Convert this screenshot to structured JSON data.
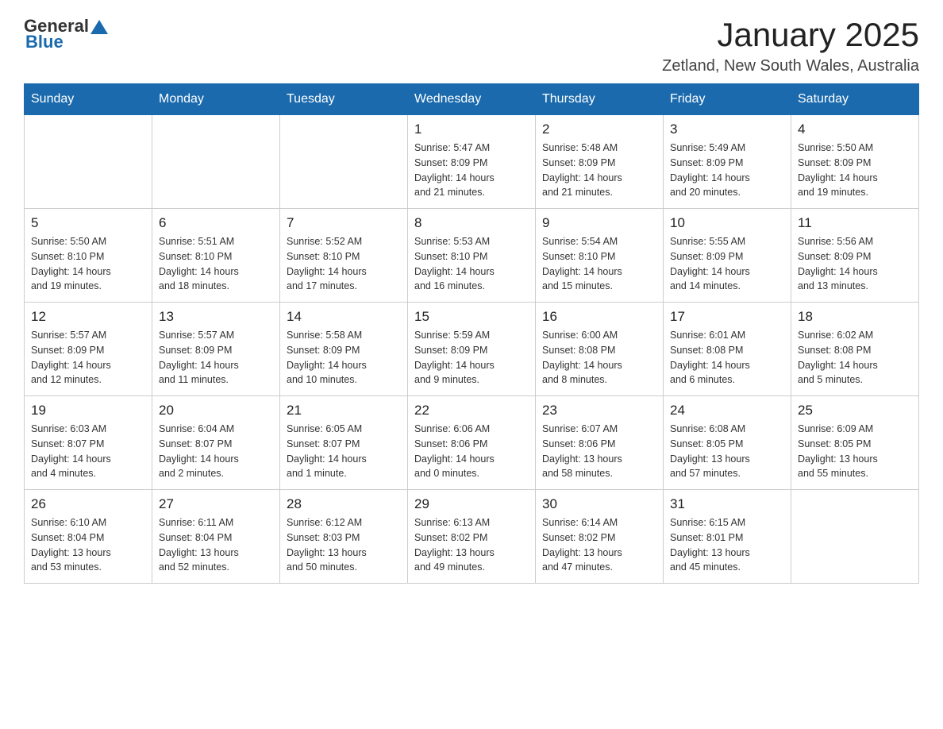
{
  "logo": {
    "general": "General",
    "blue": "Blue"
  },
  "title": "January 2025",
  "location": "Zetland, New South Wales, Australia",
  "days_of_week": [
    "Sunday",
    "Monday",
    "Tuesday",
    "Wednesday",
    "Thursday",
    "Friday",
    "Saturday"
  ],
  "weeks": [
    [
      {
        "day": "",
        "info": ""
      },
      {
        "day": "",
        "info": ""
      },
      {
        "day": "",
        "info": ""
      },
      {
        "day": "1",
        "info": "Sunrise: 5:47 AM\nSunset: 8:09 PM\nDaylight: 14 hours\nand 21 minutes."
      },
      {
        "day": "2",
        "info": "Sunrise: 5:48 AM\nSunset: 8:09 PM\nDaylight: 14 hours\nand 21 minutes."
      },
      {
        "day": "3",
        "info": "Sunrise: 5:49 AM\nSunset: 8:09 PM\nDaylight: 14 hours\nand 20 minutes."
      },
      {
        "day": "4",
        "info": "Sunrise: 5:50 AM\nSunset: 8:09 PM\nDaylight: 14 hours\nand 19 minutes."
      }
    ],
    [
      {
        "day": "5",
        "info": "Sunrise: 5:50 AM\nSunset: 8:10 PM\nDaylight: 14 hours\nand 19 minutes."
      },
      {
        "day": "6",
        "info": "Sunrise: 5:51 AM\nSunset: 8:10 PM\nDaylight: 14 hours\nand 18 minutes."
      },
      {
        "day": "7",
        "info": "Sunrise: 5:52 AM\nSunset: 8:10 PM\nDaylight: 14 hours\nand 17 minutes."
      },
      {
        "day": "8",
        "info": "Sunrise: 5:53 AM\nSunset: 8:10 PM\nDaylight: 14 hours\nand 16 minutes."
      },
      {
        "day": "9",
        "info": "Sunrise: 5:54 AM\nSunset: 8:10 PM\nDaylight: 14 hours\nand 15 minutes."
      },
      {
        "day": "10",
        "info": "Sunrise: 5:55 AM\nSunset: 8:09 PM\nDaylight: 14 hours\nand 14 minutes."
      },
      {
        "day": "11",
        "info": "Sunrise: 5:56 AM\nSunset: 8:09 PM\nDaylight: 14 hours\nand 13 minutes."
      }
    ],
    [
      {
        "day": "12",
        "info": "Sunrise: 5:57 AM\nSunset: 8:09 PM\nDaylight: 14 hours\nand 12 minutes."
      },
      {
        "day": "13",
        "info": "Sunrise: 5:57 AM\nSunset: 8:09 PM\nDaylight: 14 hours\nand 11 minutes."
      },
      {
        "day": "14",
        "info": "Sunrise: 5:58 AM\nSunset: 8:09 PM\nDaylight: 14 hours\nand 10 minutes."
      },
      {
        "day": "15",
        "info": "Sunrise: 5:59 AM\nSunset: 8:09 PM\nDaylight: 14 hours\nand 9 minutes."
      },
      {
        "day": "16",
        "info": "Sunrise: 6:00 AM\nSunset: 8:08 PM\nDaylight: 14 hours\nand 8 minutes."
      },
      {
        "day": "17",
        "info": "Sunrise: 6:01 AM\nSunset: 8:08 PM\nDaylight: 14 hours\nand 6 minutes."
      },
      {
        "day": "18",
        "info": "Sunrise: 6:02 AM\nSunset: 8:08 PM\nDaylight: 14 hours\nand 5 minutes."
      }
    ],
    [
      {
        "day": "19",
        "info": "Sunrise: 6:03 AM\nSunset: 8:07 PM\nDaylight: 14 hours\nand 4 minutes."
      },
      {
        "day": "20",
        "info": "Sunrise: 6:04 AM\nSunset: 8:07 PM\nDaylight: 14 hours\nand 2 minutes."
      },
      {
        "day": "21",
        "info": "Sunrise: 6:05 AM\nSunset: 8:07 PM\nDaylight: 14 hours\nand 1 minute."
      },
      {
        "day": "22",
        "info": "Sunrise: 6:06 AM\nSunset: 8:06 PM\nDaylight: 14 hours\nand 0 minutes."
      },
      {
        "day": "23",
        "info": "Sunrise: 6:07 AM\nSunset: 8:06 PM\nDaylight: 13 hours\nand 58 minutes."
      },
      {
        "day": "24",
        "info": "Sunrise: 6:08 AM\nSunset: 8:05 PM\nDaylight: 13 hours\nand 57 minutes."
      },
      {
        "day": "25",
        "info": "Sunrise: 6:09 AM\nSunset: 8:05 PM\nDaylight: 13 hours\nand 55 minutes."
      }
    ],
    [
      {
        "day": "26",
        "info": "Sunrise: 6:10 AM\nSunset: 8:04 PM\nDaylight: 13 hours\nand 53 minutes."
      },
      {
        "day": "27",
        "info": "Sunrise: 6:11 AM\nSunset: 8:04 PM\nDaylight: 13 hours\nand 52 minutes."
      },
      {
        "day": "28",
        "info": "Sunrise: 6:12 AM\nSunset: 8:03 PM\nDaylight: 13 hours\nand 50 minutes."
      },
      {
        "day": "29",
        "info": "Sunrise: 6:13 AM\nSunset: 8:02 PM\nDaylight: 13 hours\nand 49 minutes."
      },
      {
        "day": "30",
        "info": "Sunrise: 6:14 AM\nSunset: 8:02 PM\nDaylight: 13 hours\nand 47 minutes."
      },
      {
        "day": "31",
        "info": "Sunrise: 6:15 AM\nSunset: 8:01 PM\nDaylight: 13 hours\nand 45 minutes."
      },
      {
        "day": "",
        "info": ""
      }
    ]
  ]
}
